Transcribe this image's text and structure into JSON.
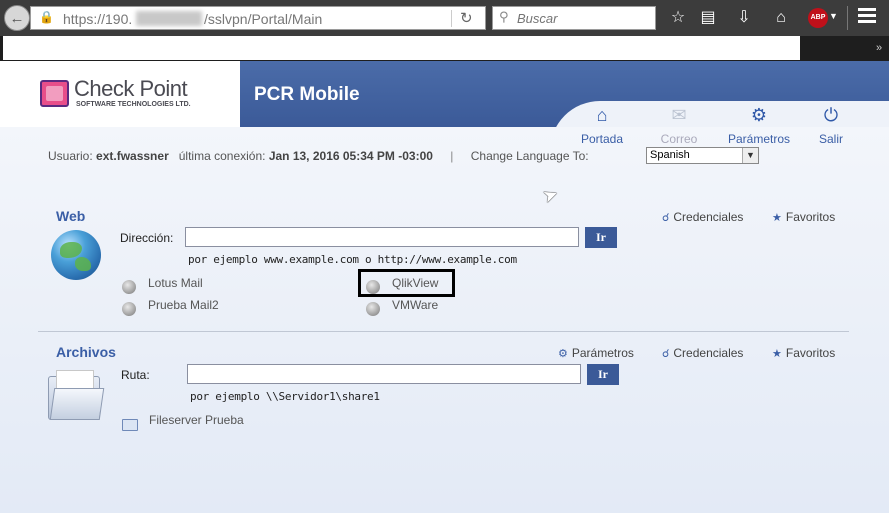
{
  "browser": {
    "url_prefix": "https://190.",
    "url_path": "/sslvpn/Portal/Main",
    "search_placeholder": "Buscar",
    "abp_label": "ABP"
  },
  "logo": {
    "title": "Check Point",
    "subtitle": "SOFTWARE TECHNOLOGIES LTD."
  },
  "banner": {
    "title": "PCR Mobile"
  },
  "nav": {
    "portada": "Portada",
    "correo": "Correo",
    "parametros": "Parámetros",
    "salir": "Salir"
  },
  "userinfo": {
    "user_label": "Usuario:",
    "user": "ext.fwassner",
    "last_login_label": "última conexión:",
    "last_login": "Jan 13, 2016 05:34 PM -03:00",
    "separator": "|",
    "change_language_label": "Change Language To:",
    "language": "Spanish"
  },
  "web": {
    "title": "Web",
    "credenciales": "Credenciales",
    "favoritos": "Favoritos",
    "address_label": "Dirección:",
    "address_value": "",
    "go_label": "Ir",
    "hint": "por ejemplo  www.example.com  o  http://www.example.com",
    "bookmarks": [
      "Lotus Mail",
      "Prueba Mail2",
      "QlikView",
      "VMWare"
    ]
  },
  "files": {
    "title": "Archivos",
    "parametros": "Parámetros",
    "credenciales": "Credenciales",
    "favoritos": "Favoritos",
    "path_label": "Ruta:",
    "path_value": "",
    "go_label": "Ir",
    "hint": "por ejemplo  \\\\Servidor1\\share1",
    "bookmarks": [
      "Fileserver Prueba"
    ]
  }
}
